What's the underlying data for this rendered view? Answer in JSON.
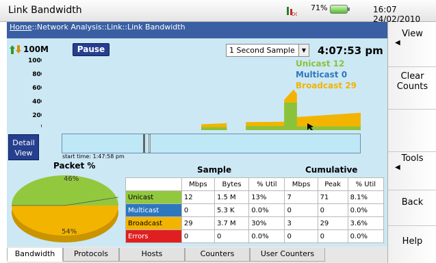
{
  "app": {
    "title": "Link Bandwidth",
    "battery": "71%",
    "clock": "16:07 24/02/2010"
  },
  "breadcrumb": {
    "home": "Home",
    "path": "::Network Analysis::Link::Link Bandwidth"
  },
  "toolbar": {
    "speed": "100M",
    "pause_label": "Pause",
    "sample_select": "1 Second Sample",
    "elapsed": "4:07:53 pm"
  },
  "chart_data": {
    "type": "area",
    "y_ticks": [
      "1000",
      "800",
      "600",
      "400",
      "200",
      "0"
    ],
    "ylim": [
      0,
      1000
    ],
    "legend": [
      {
        "label": "Unicast 12",
        "color": "#8ac33b"
      },
      {
        "label": "Multicast 0",
        "color": "#2e77bd"
      },
      {
        "label": "Broadcast 29",
        "color": "#f3b400"
      }
    ],
    "series": [
      {
        "name": "Broadcast",
        "color": "#f3b400",
        "points": [
          [
            0.5,
            0
          ],
          [
            0.5,
            80
          ],
          [
            0.58,
            95
          ],
          [
            0.58,
            0
          ],
          [
            0.64,
            0
          ],
          [
            0.64,
            110
          ],
          [
            0.76,
            115
          ],
          [
            0.76,
            0
          ],
          [
            0.76,
            420
          ],
          [
            0.79,
            560
          ],
          [
            0.8,
            500
          ],
          [
            0.8,
            180
          ],
          [
            1.0,
            240
          ]
        ]
      },
      {
        "name": "Unicast",
        "color": "#8ac33b",
        "points": [
          [
            0.5,
            0
          ],
          [
            0.5,
            40
          ],
          [
            0.58,
            40
          ],
          [
            0.58,
            0
          ],
          [
            0.64,
            0
          ],
          [
            0.64,
            55
          ],
          [
            0.76,
            55
          ],
          [
            0.76,
            0
          ],
          [
            0.76,
            380
          ],
          [
            0.8,
            380
          ],
          [
            0.8,
            50
          ],
          [
            1.0,
            50
          ]
        ]
      }
    ]
  },
  "detail": {
    "label_line1": "Detail",
    "label_line2": "View",
    "start_time": "start time: 1:47:58 pm"
  },
  "pie": {
    "title": "Packet %",
    "pct_top": "46%",
    "pct_bottom": "54%"
  },
  "table": {
    "sample_title": "Sample",
    "cumulative_title": "Cumulative",
    "headers": [
      "",
      "Mbps",
      "Bytes",
      "% Util",
      "Mbps",
      "Peak",
      "% Util"
    ],
    "rows": [
      {
        "label": "Unicast",
        "cls": "lbl-uni",
        "cells": [
          "12",
          "1.5 M",
          "13%",
          "7",
          "71",
          "8.1%"
        ]
      },
      {
        "label": "Multicast",
        "cls": "lbl-multi",
        "cells": [
          "0",
          "5.3 K",
          "0.0%",
          "0",
          "0",
          "0.0%"
        ]
      },
      {
        "label": "Broadcast",
        "cls": "lbl-bcast",
        "cells": [
          "29",
          "3.7 M",
          "30%",
          "3",
          "29",
          "3.6%"
        ]
      },
      {
        "label": "Errors",
        "cls": "lbl-err",
        "cells": [
          "0",
          "0",
          "0.0%",
          "0",
          "0",
          "0.0%"
        ]
      }
    ]
  },
  "tabs": [
    "Bandwidth",
    "Protocols",
    "Hosts",
    "Counters",
    "User Counters"
  ],
  "right_menu": {
    "view": "View",
    "clear1": "Clear",
    "clear2": "Counts",
    "tools": "Tools",
    "back": "Back",
    "help": "Help"
  }
}
